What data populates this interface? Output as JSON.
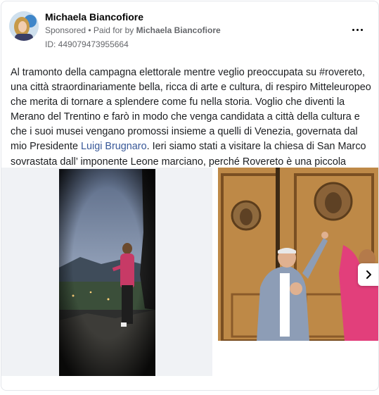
{
  "post": {
    "author": "Michaela Biancofiore",
    "sponsored": "Sponsored",
    "paid_for_prefix": " • Paid for by ",
    "paid_for_name": "Michaela Biancofiore",
    "ad_id": "ID: 449079473955664",
    "text_before_link": "Al tramonto della campagna elettorale mentre veglio preoccupata su #rovereto, una città straordinariamente bella, ricca di arte e cultura, di respiro Mitteleuropeo che merita di tornare a splendere come fu nella storia. Voglio che diventi la Merano del Trentino e farò in modo che venga candidata a città della cultura e che i suoi musei vengano promossi insieme a quelli di Venezia, governata dal mio Presidente ",
    "link_text": "Luigi Brugnaro",
    "text_after_link": ". Ieri siamo stati a visitare la chiesa di San Marco sovrastata dall’ imponente Leone marciano, perché Rovereto è una piccola Venezia.In bocca al..."
  },
  "icons": {
    "more": "more-options-icon",
    "next": "chevron-right-icon"
  },
  "colors": {
    "link": "#385898",
    "secondary_text": "#65676b"
  }
}
